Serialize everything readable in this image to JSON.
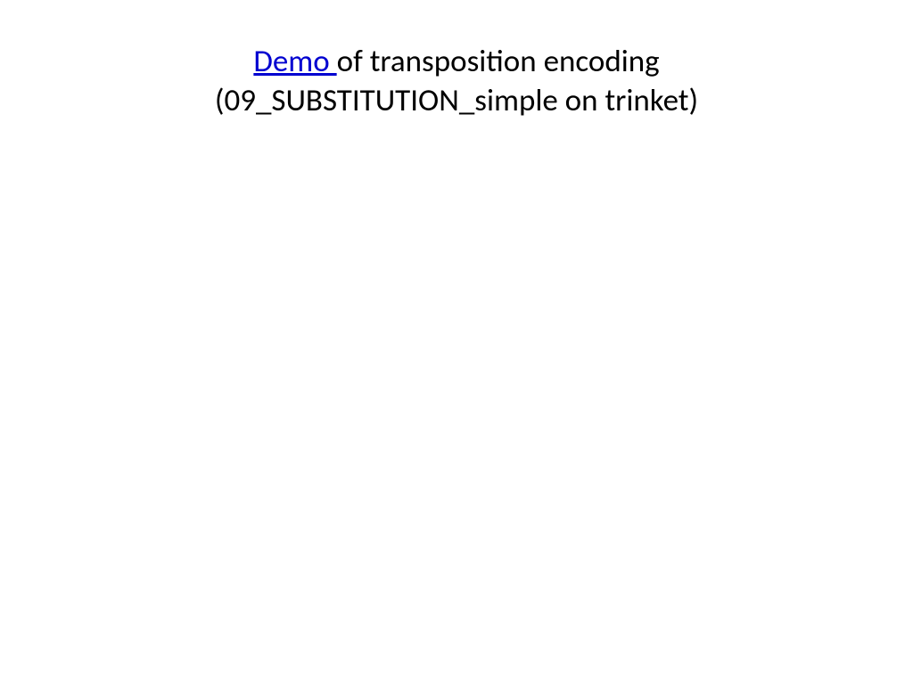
{
  "slide": {
    "title": {
      "link_text": "Demo ",
      "rest_line1": "of transposition encoding",
      "line2": "(09_SUBSTITUTION_simple on trinket)"
    }
  }
}
